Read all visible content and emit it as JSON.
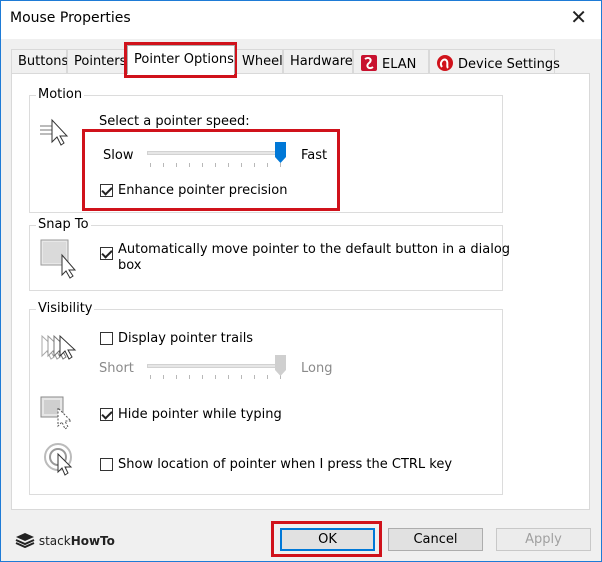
{
  "window": {
    "title": "Mouse Properties"
  },
  "tabs": [
    {
      "label": "Buttons"
    },
    {
      "label": "Pointers"
    },
    {
      "label": "Pointer Options"
    },
    {
      "label": "Wheel"
    },
    {
      "label": "Hardware"
    },
    {
      "label": "ELAN",
      "icon": "elan-icon"
    },
    {
      "label": "Device Settings",
      "icon": "synaptics-icon"
    }
  ],
  "motion": {
    "group_label": "Motion",
    "speed_label": "Select a pointer speed:",
    "slow_label": "Slow",
    "fast_label": "Fast",
    "speed_value": 1.0,
    "precision_label": "Enhance pointer precision",
    "precision_checked": true
  },
  "snap": {
    "group_label": "Snap To",
    "auto_label_line1": "Automatically move pointer to the default button in a dialog",
    "auto_label_line2": "box",
    "auto_checked": true
  },
  "visibility": {
    "group_label": "Visibility",
    "trails_label": "Display pointer trails",
    "trails_checked": false,
    "short_label": "Short",
    "long_label": "Long",
    "trail_value": 1.0,
    "hide_label": "Hide pointer while typing",
    "hide_checked": true,
    "ctrl_label": "Show location of pointer when I press the CTRL key",
    "ctrl_checked": false
  },
  "buttons": {
    "ok": "OK",
    "cancel": "Cancel",
    "apply": "Apply"
  },
  "watermark": {
    "text_a": "stack",
    "text_b": "HowTo"
  },
  "colors": {
    "accent": "#0078d7",
    "highlight": "#d0121b"
  }
}
